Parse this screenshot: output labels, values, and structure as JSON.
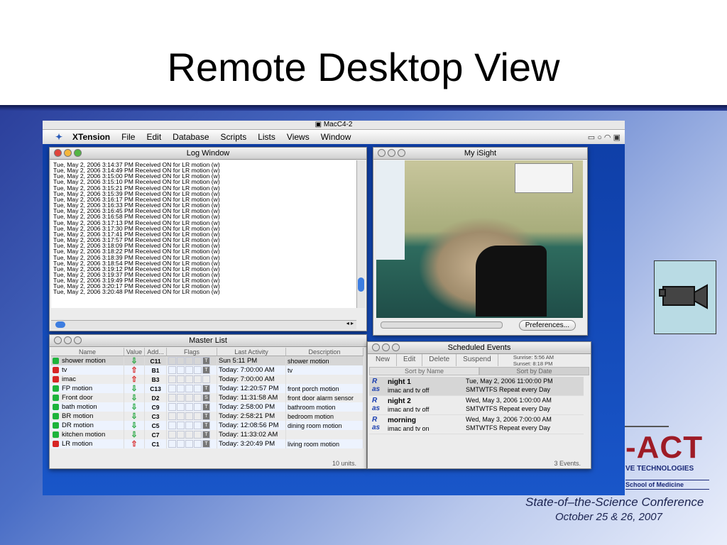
{
  "slide": {
    "title": "Remote Desktop View",
    "conference_line1": "State-of–the-Science Conference",
    "conference_line2": "October 25 & 26, 2007",
    "logo_text": "-ACT",
    "logo_sub": "VE TECHNOLOGIES",
    "logo_school": "School of Medicine"
  },
  "remote": {
    "title": "MacC4-2",
    "menubar": [
      "XTension",
      "File",
      "Edit",
      "Database",
      "Scripts",
      "Lists",
      "Views",
      "Window"
    ]
  },
  "log_window": {
    "title": "Log Window",
    "lines": [
      "Tue, May 2, 2006 3:14:37 PM Received ON for LR motion (w)",
      "Tue, May 2, 2006 3:14:49 PM Received ON for LR motion (w)",
      "Tue, May 2, 2006 3:15:00 PM Received ON for LR motion (w)",
      "Tue, May 2, 2006 3:15:10 PM Received ON for LR motion (w)",
      "Tue, May 2, 2006 3:15:21 PM Received ON for LR motion (w)",
      "Tue, May 2, 2006 3:15:39 PM Received ON for LR motion (w)",
      "Tue, May 2, 2006 3:16:17 PM Received ON for LR motion (w)",
      "Tue, May 2, 2006 3:16:33 PM Received ON for LR motion (w)",
      "Tue, May 2, 2006 3:16:45 PM Received ON for LR motion (w)",
      "Tue, May 2, 2006 3:16:58 PM Received ON for LR motion (w)",
      "Tue, May 2, 2006 3:17:13 PM Received ON for LR motion (w)",
      "Tue, May 2, 2006 3:17:30 PM Received ON for LR motion (w)",
      "Tue, May 2, 2006 3:17:41 PM Received ON for LR motion (w)",
      "Tue, May 2, 2006 3:17:57 PM Received ON for LR motion (w)",
      "Tue, May 2, 2006 3:18:09 PM Received ON for LR motion (w)",
      "Tue, May 2, 2006 3:18:22 PM Received ON for LR motion (w)",
      "Tue, May 2, 2006 3:18:39 PM Received ON for LR motion (w)",
      "Tue, May 2, 2006 3:18:54 PM Received ON for LR motion (w)",
      "Tue, May 2, 2006 3:19:12 PM Received ON for LR motion (w)",
      "Tue, May 2, 2006 3:19:37 PM Received ON for LR motion (w)",
      "Tue, May 2, 2006 3:19:49 PM Received ON for LR motion (w)",
      "Tue, May 2, 2006 3:20:17 PM Received ON for LR motion (w)",
      "Tue, May 2, 2006 3:20:48 PM Received ON for LR motion (w)"
    ]
  },
  "isight": {
    "title": "My iSight",
    "preferences_label": "Preferences..."
  },
  "master_list": {
    "title": "Master List",
    "columns": [
      "Name",
      "Value",
      "Add...",
      "Flags",
      "Last Activity",
      "Description"
    ],
    "rows": [
      {
        "name": "shower motion",
        "status": "green",
        "value": "down",
        "addr": "C11",
        "flag": "T",
        "activity": "Sun 5:11 PM",
        "desc": "shower motion"
      },
      {
        "name": "tv",
        "status": "red",
        "value": "up",
        "addr": "B1",
        "flag": "T",
        "activity": "Today: 7:00:00 AM",
        "desc": "tv"
      },
      {
        "name": "imac",
        "status": "red",
        "value": "up",
        "addr": "B3",
        "flag": "",
        "activity": "Today: 7:00:00 AM",
        "desc": ""
      },
      {
        "name": "FP motion",
        "status": "green",
        "value": "down",
        "addr": "C13",
        "flag": "T",
        "activity": "Today: 12:20:57 PM",
        "desc": "front porch motion"
      },
      {
        "name": "Front door",
        "status": "green",
        "value": "down",
        "addr": "D2",
        "flag": "S",
        "activity": "Today: 11:31:58 AM",
        "desc": "front door alarm sensor"
      },
      {
        "name": "bath motion",
        "status": "green",
        "value": "down",
        "addr": "C9",
        "flag": "T",
        "activity": "Today: 2:58:00 PM",
        "desc": "bathroom motion"
      },
      {
        "name": "BR motion",
        "status": "green",
        "value": "down",
        "addr": "C3",
        "flag": "T",
        "activity": "Today: 2:58:21 PM",
        "desc": "bedroom motion"
      },
      {
        "name": "DR motion",
        "status": "green",
        "value": "down",
        "addr": "C5",
        "flag": "T",
        "activity": "Today: 12:08:56 PM",
        "desc": "dining room motion"
      },
      {
        "name": "kitchen motion",
        "status": "green",
        "value": "down",
        "addr": "C7",
        "flag": "T",
        "activity": "Today: 11:33:02 AM",
        "desc": ""
      },
      {
        "name": "LR motion",
        "status": "red",
        "value": "up",
        "addr": "C1",
        "flag": "T",
        "activity": "Today: 3:20:49 PM",
        "desc": "living room motion"
      }
    ],
    "footer": "10 units."
  },
  "scheduled_events": {
    "title": "Scheduled Events",
    "toolbar": [
      "New",
      "Edit",
      "Delete",
      "Suspend"
    ],
    "sunrise": "Sunrise: 5:56 AM",
    "sunset": "Sunset: 8:18 PM",
    "sort_by_name": "Sort by Name",
    "sort_by_date": "Sort by Date",
    "events": [
      {
        "name": "night 1",
        "desc": "imac and tv off",
        "when": "Tue, May 2, 2006 11:00:00 PM",
        "days": "SMTWTFS  Repeat every Day"
      },
      {
        "name": "night 2",
        "desc": "imac and tv off",
        "when": "Wed, May 3, 2006 1:00:00 AM",
        "days": "SMTWTFS  Repeat every Day"
      },
      {
        "name": "morning",
        "desc": "imac and tv on",
        "when": "Wed, May 3, 2006 7:00:00 AM",
        "days": "SMTWTFS  Repeat every Day"
      }
    ],
    "footer": "3 Events."
  }
}
